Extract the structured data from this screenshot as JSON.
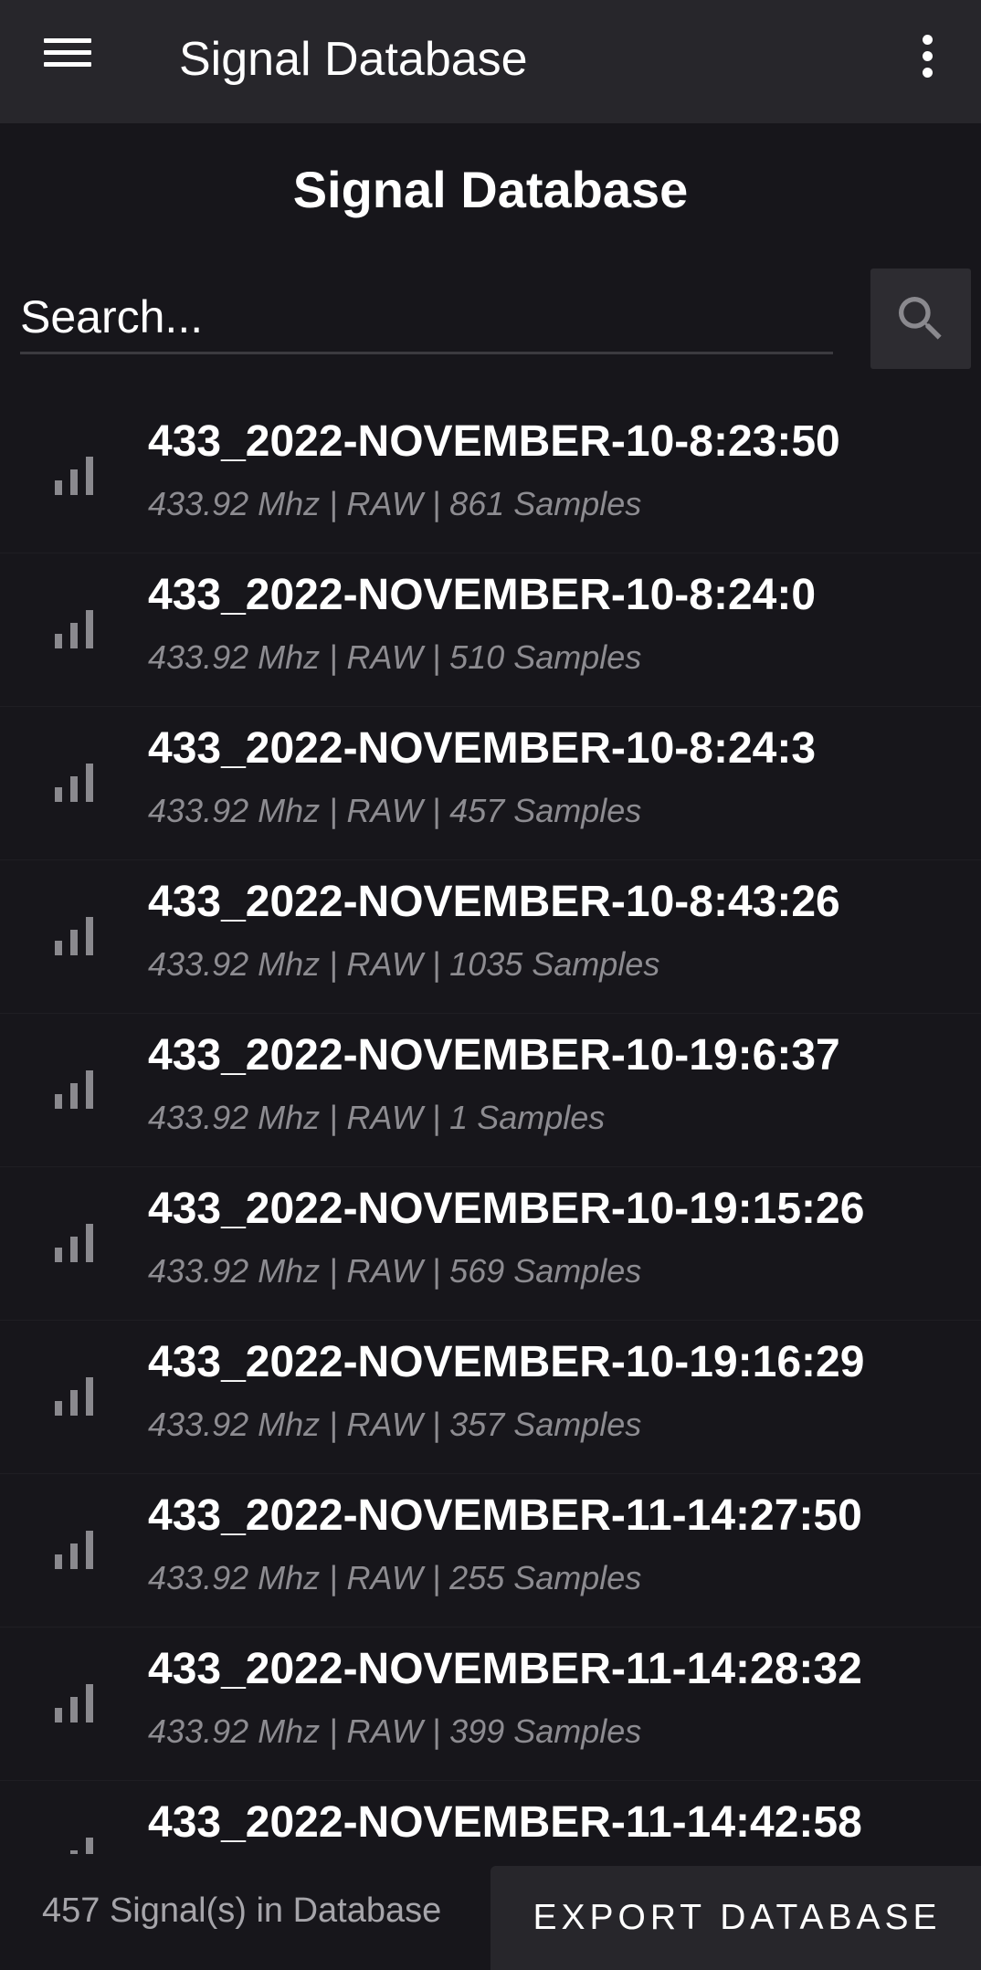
{
  "appbar": {
    "title": "Signal Database"
  },
  "page": {
    "title": "Signal Database"
  },
  "search": {
    "placeholder": "Search..."
  },
  "signals": [
    {
      "name": "433_2022-NOVEMBER-10-8:23:50",
      "details": "433.92 Mhz | RAW | 861 Samples"
    },
    {
      "name": "433_2022-NOVEMBER-10-8:24:0",
      "details": "433.92 Mhz | RAW | 510 Samples"
    },
    {
      "name": "433_2022-NOVEMBER-10-8:24:3",
      "details": "433.92 Mhz | RAW | 457 Samples"
    },
    {
      "name": "433_2022-NOVEMBER-10-8:43:26",
      "details": "433.92 Mhz | RAW | 1035 Samples"
    },
    {
      "name": "433_2022-NOVEMBER-10-19:6:37",
      "details": "433.92 Mhz | RAW | 1 Samples"
    },
    {
      "name": "433_2022-NOVEMBER-10-19:15:26",
      "details": "433.92 Mhz | RAW | 569 Samples"
    },
    {
      "name": "433_2022-NOVEMBER-10-19:16:29",
      "details": "433.92 Mhz | RAW | 357 Samples"
    },
    {
      "name": "433_2022-NOVEMBER-11-14:27:50",
      "details": "433.92 Mhz | RAW | 255 Samples"
    },
    {
      "name": "433_2022-NOVEMBER-11-14:28:32",
      "details": "433.92 Mhz | RAW | 399 Samples"
    },
    {
      "name": "433_2022-NOVEMBER-11-14:42:58",
      "details": ""
    }
  ],
  "footer": {
    "count_text": "457 Signal(s) in Database",
    "export_label": "EXPORT DATABASE"
  },
  "icons": {
    "menu": "hamburger-menu-icon",
    "more": "more-vert-icon",
    "search": "search-icon",
    "signal": "signal-strength-icon"
  },
  "colors": {
    "background": "#17161b",
    "appbar": "#27262b",
    "text_primary": "#ffffff",
    "text_secondary": "#8d8c91",
    "icon_muted": "#8a898e"
  }
}
